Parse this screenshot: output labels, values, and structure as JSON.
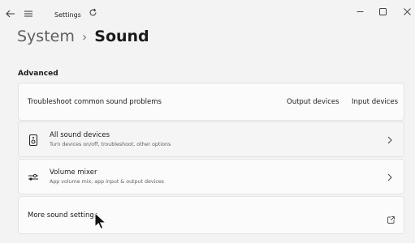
{
  "window": {
    "app_title": "Settings",
    "controls": {
      "minimize": "minimize-icon",
      "maximize": "maximize-icon",
      "close": "close-icon"
    }
  },
  "breadcrumb": {
    "parent": "System",
    "separator": "›",
    "current": "Sound"
  },
  "section": {
    "label": "Advanced"
  },
  "troubleshoot": {
    "label": "Troubleshoot common sound problems",
    "output_link": "Output devices",
    "input_link": "Input devices"
  },
  "all_devices": {
    "title": "All sound devices",
    "subtitle": "Turn devices on/off, troubleshoot, other options",
    "icon": "speaker-icon"
  },
  "volume_mixer": {
    "title": "Volume mixer",
    "subtitle": "App volume mix, app input & output devices",
    "icon": "mixer-icon"
  },
  "more_settings": {
    "label": "More sound settings",
    "icon": "external-link-icon"
  },
  "colors": {
    "background": "#f3f3f3",
    "card": "#fbfbfb",
    "border": "#e3e3e3",
    "text": "#1b1b1b",
    "subtext": "#5e5e5e"
  }
}
